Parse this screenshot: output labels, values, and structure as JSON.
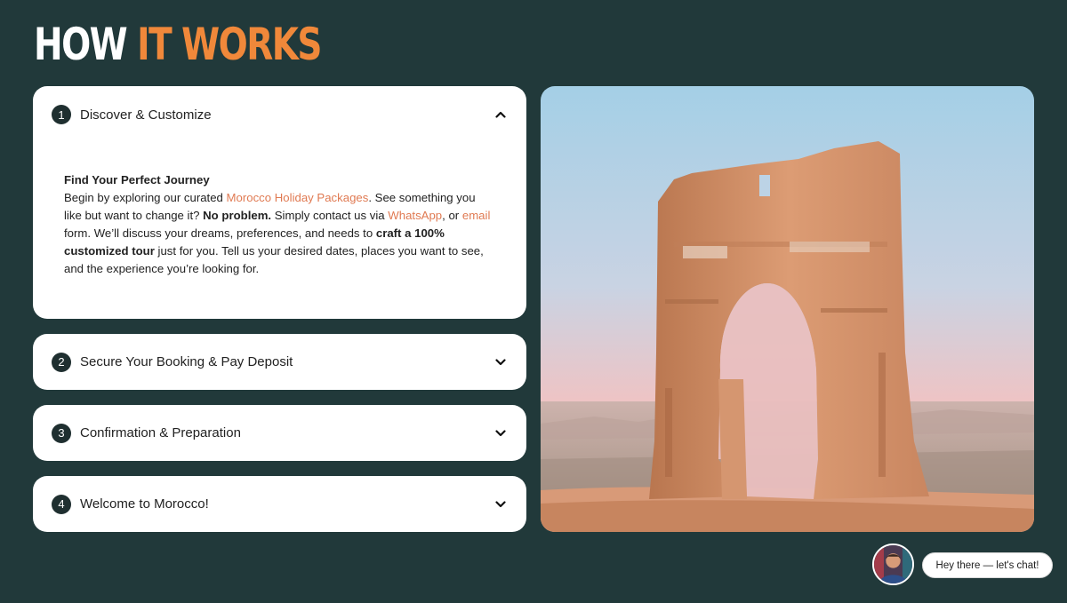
{
  "heading": {
    "part1": "HOW ",
    "part2": "IT WORKS"
  },
  "colors": {
    "background": "#21393a",
    "accent": "#f0883a",
    "link": "#e07a52"
  },
  "steps": [
    {
      "number": "1",
      "title": "Discover & Customize",
      "expanded": true,
      "chevron": "chevron-up-icon",
      "content": {
        "subtitle": "Find Your Perfect Journey",
        "t1": "Begin by exploring our curated ",
        "link1": "Morocco Holiday Packages",
        "t2": ". See something you like but want to change it? ",
        "b1": "No problem.",
        "t3": " Simply contact us via ",
        "link2": "WhatsApp",
        "t4": ", or ",
        "link3": "email",
        "t5": " form. We’ll discuss your dreams, preferences, and needs to ",
        "b2": "craft a 100% customized tour",
        "t6": " just for you. Tell us your desired dates, places you want to see, and the experience you’re looking for."
      }
    },
    {
      "number": "2",
      "title": "Secure Your Booking & Pay Deposit",
      "expanded": false,
      "chevron": "chevron-down-icon"
    },
    {
      "number": "3",
      "title": "Confirmation & Preparation",
      "expanded": false,
      "chevron": "chevron-down-icon"
    },
    {
      "number": "4",
      "title": "Welcome to Morocco!",
      "expanded": false,
      "chevron": "chevron-down-icon"
    }
  ],
  "chat": {
    "bubble_text": "Hey there — let's chat!"
  }
}
